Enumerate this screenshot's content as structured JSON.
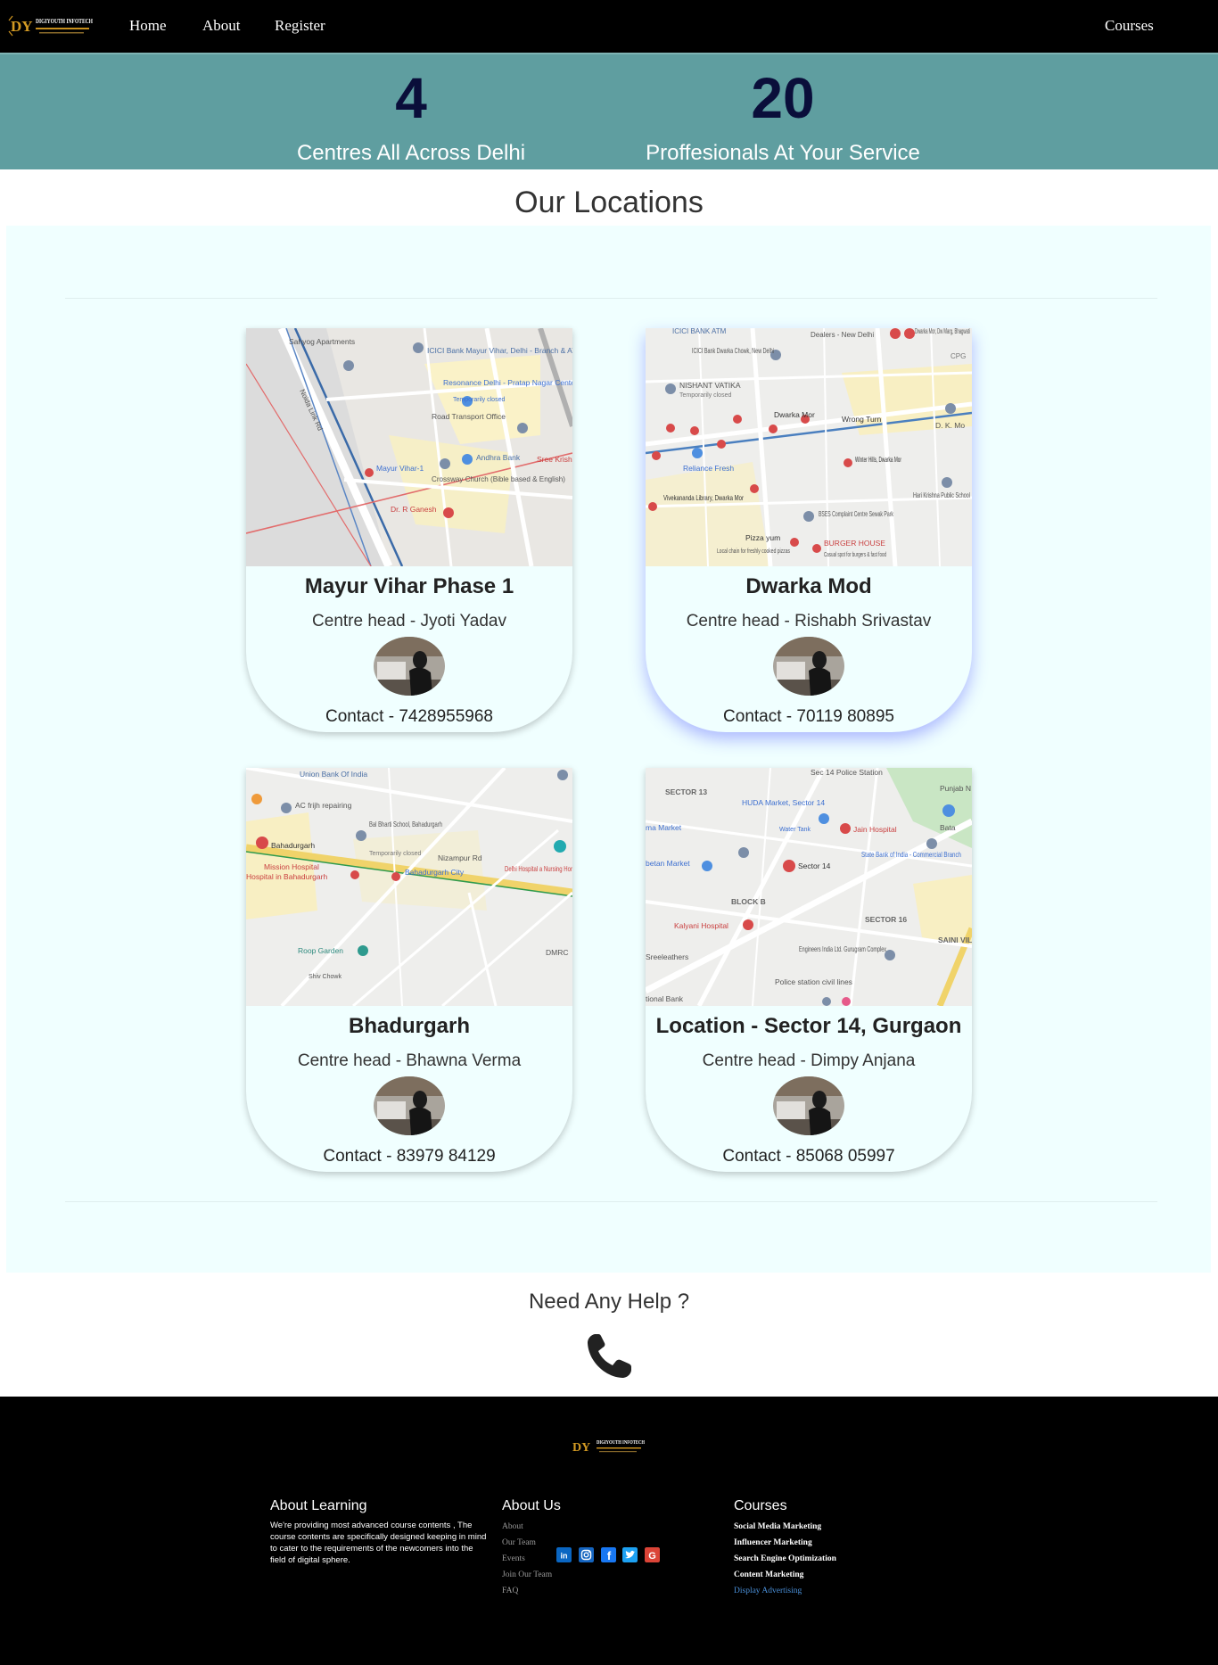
{
  "nav": {
    "brand": "DIGIYOUTH INFOTECH",
    "logo_mark": "DY",
    "links": [
      "Home",
      "About",
      "Register"
    ],
    "right_link": "Courses"
  },
  "stats": [
    {
      "value": "4",
      "label": "Centres All Across Delhi"
    },
    {
      "value": "20",
      "label": "Proffesionals At Your Service"
    }
  ],
  "locations": {
    "title": "Our Locations",
    "cards": [
      {
        "name": "Mayur Vihar Phase 1",
        "head": "Centre head - Jyoti Yadav",
        "contact": "Contact - 7428955968",
        "map_labels": [
          "Sahyog Apartments",
          "ICICI Bank Mayur Vihar, Delhi - Branch & ATM",
          "Resonance Delhi - Pratap Nagar Center",
          "Temporarily closed",
          "Road Transport Office",
          "Andhra Bank",
          "Mayur Vihar-1",
          "Crossway Church (Bible based & English)",
          "Dr. R Ganesh",
          "Noida Link Rd",
          "Sree Krish & Rese"
        ]
      },
      {
        "name": "Dwarka Mod",
        "head": "Centre head - Rishabh Srivastav",
        "contact": "Contact - 70119 80895",
        "map_labels": [
          "ICICI BANK ATM",
          "Dealers - New Delhi",
          "Dwarka Mor, Dw Marg, Bhagwati",
          "ICICI Bank Dwarka Chowk, New Delhi",
          "NISHANT VATIKA",
          "Temporarily closed",
          "Dwarka Mor",
          "Wrong Turn",
          "D. K. Mo",
          "Reliance Fresh",
          "Winter Hills, Dwarka Mor",
          "Vivekananda Library, Dwarka Mor",
          "Hari Krishna Public School",
          "BSES Complaint Centre Sewak Park",
          "Pizza yum",
          "Local chain for freshly cooked pizzas",
          "BURGER HOUSE",
          "Casual spot for burgers & fast food",
          "CPG"
        ]
      },
      {
        "name": "Bhadurgarh",
        "head": "Centre head - Bhawna Verma",
        "contact": "Contact - 83979 84129",
        "map_labels": [
          "Union Bank Of India",
          "AC frijh repairing",
          "Bal Bharti School, Bahadurgarh",
          "Temporarily closed",
          "Bahadurgarh",
          "Nizampur Rd",
          "Mission Hospital",
          "Hospital in Bahadurgarh",
          "Bahadurgarh City",
          "Delhi Hospital a Nursing Hor",
          "Roop Garden",
          "DMRC",
          "Shiv Chowk"
        ]
      },
      {
        "name": "Location - Sector 14, Gurgaon",
        "head": "Centre head - Dimpy Anjana",
        "contact": "Contact - 85068 05997",
        "map_labels": [
          "Sec 14 Police Station",
          "SECTOR 13",
          "HUDA Market, Sector 14",
          "Punjab N",
          "ma Market",
          "Water Tank",
          "Jain Hospital",
          "Bata",
          "betan Market",
          "State Bank of India - Commercial Branch",
          "Sector 14",
          "BLOCK B",
          "SECTOR 16",
          "Kalyani Hospital",
          "SAINI VILL",
          "Sreeleathers",
          "Engineers India Ltd. Gurugram Complex",
          "Police station civil lines",
          "tional Bank"
        ]
      }
    ]
  },
  "help": {
    "title": "Need Any Help ?",
    "icon": "phone-icon"
  },
  "footer": {
    "brand": "DIGIYOUTH INFOTECH",
    "columns": {
      "about_learning": {
        "title": "About Learning",
        "text": "We're providing most advanced course contents , The course contents are specifically designed keeping in mind to cater to the requirements of the newcomers into the field of digital sphere."
      },
      "about_us": {
        "title": "About Us",
        "links": [
          "About",
          "Our Team",
          "Events",
          "Join Our Team",
          "FAQ"
        ]
      },
      "courses": {
        "title": "Courses",
        "links": [
          "Social Media Marketing",
          "Influencer Marketing",
          "Search Engine Optimization",
          "Content Marketing",
          "Display Advertising"
        ]
      }
    },
    "social": [
      {
        "icon": "linkedin-icon",
        "glyph": "in",
        "color": "#0a66c2"
      },
      {
        "icon": "instagram-icon",
        "glyph": "◎",
        "color": "#1565c0"
      },
      {
        "icon": "facebook-icon",
        "glyph": "f",
        "color": "#1877f2"
      },
      {
        "icon": "twitter-icon",
        "glyph": "t",
        "color": "#1da1f2"
      },
      {
        "icon": "google-icon",
        "glyph": "G",
        "color": "#db4437"
      }
    ]
  },
  "colors": {
    "nav_bg": "#000000",
    "stats_bg": "#5f9ea0",
    "stat_number": "#0a0e3a",
    "locations_bg": "#f0ffff",
    "display_advertising_link": "#4a8fd8"
  }
}
